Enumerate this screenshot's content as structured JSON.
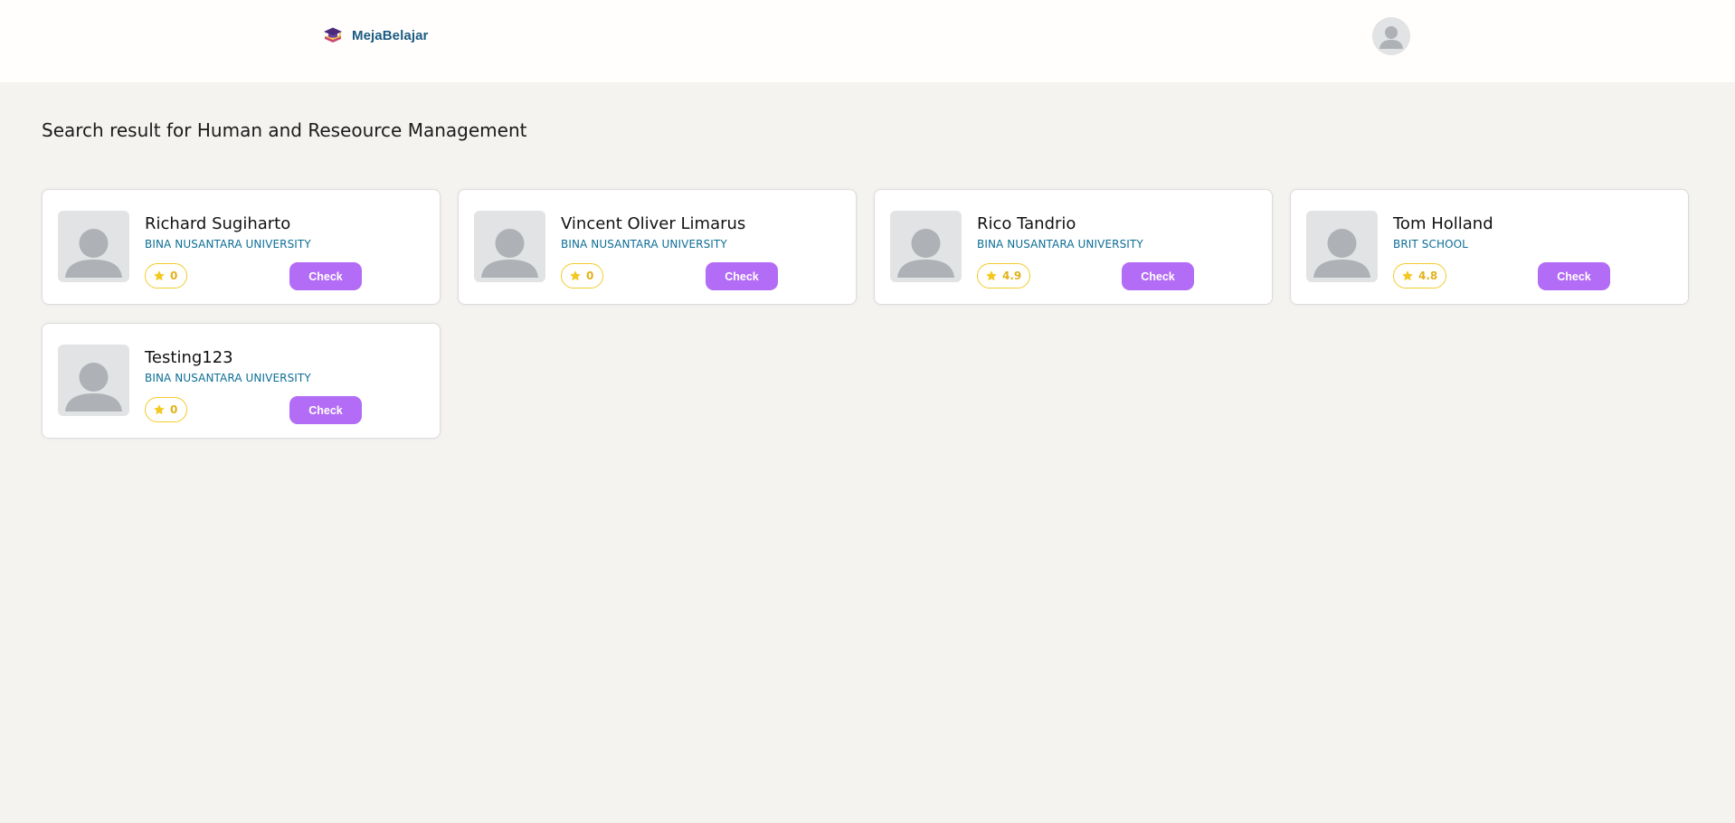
{
  "header": {
    "brand_name": "MejaBelajar",
    "brand_icon": "graduation-book-icon",
    "profile_icon": "user-avatar-icon"
  },
  "search": {
    "title": "Search result for Human and Reseource Management"
  },
  "results": [
    {
      "name": "Richard Sugiharto",
      "school": "BINA NUSANTARA UNIVERSITY",
      "rating": "0",
      "check_label": "Check"
    },
    {
      "name": "Vincent Oliver Limarus",
      "school": "BINA NUSANTARA UNIVERSITY",
      "rating": "0",
      "check_label": "Check"
    },
    {
      "name": "Rico Tandrio",
      "school": "BINA NUSANTARA UNIVERSITY",
      "rating": "4.9",
      "check_label": "Check"
    },
    {
      "name": "Tom Holland",
      "school": "BRIT SCHOOL",
      "rating": "4.8",
      "check_label": "Check"
    },
    {
      "name": "Testing123",
      "school": "BINA NUSANTARA UNIVERSITY",
      "rating": "0",
      "check_label": "Check"
    }
  ],
  "colors": {
    "page_background": "#f4f3f0",
    "brand_text": "#1b5a82",
    "school_text": "#0d6e95",
    "button": "#b36cf5",
    "rating_accent": "#f3cb2c"
  }
}
